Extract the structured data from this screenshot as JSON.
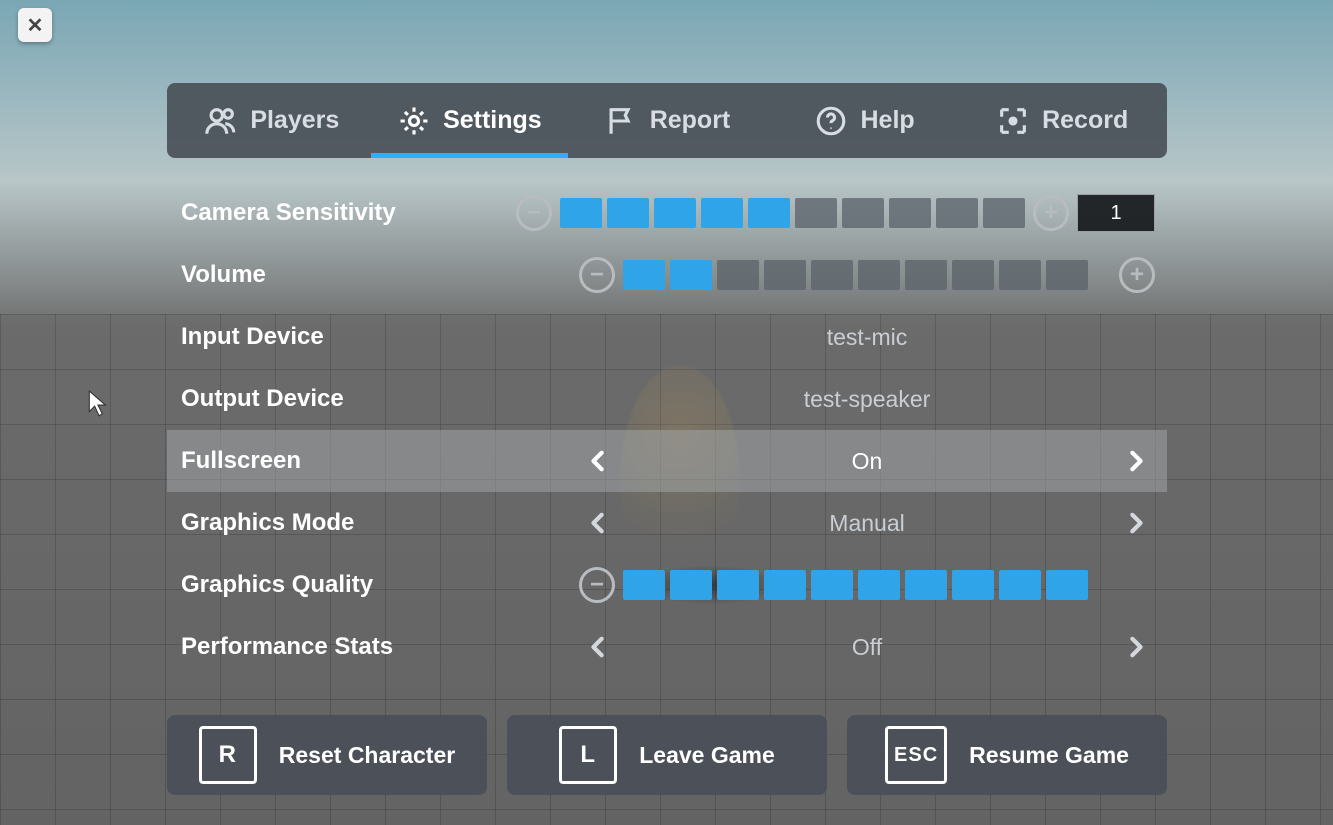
{
  "close_label": "✕",
  "tabs": {
    "players": "Players",
    "settings": "Settings",
    "report": "Report",
    "help": "Help",
    "record": "Record"
  },
  "settings": {
    "camera_sensitivity": {
      "label": "Camera Sensitivity",
      "filled": 5,
      "total": 10,
      "value": "1"
    },
    "volume": {
      "label": "Volume",
      "filled": 2,
      "total": 10
    },
    "input_device": {
      "label": "Input Device",
      "value": "test-mic"
    },
    "output_device": {
      "label": "Output Device",
      "value": "test-speaker"
    },
    "fullscreen": {
      "label": "Fullscreen",
      "value": "On"
    },
    "graphics_mode": {
      "label": "Graphics Mode",
      "value": "Manual"
    },
    "graphics_quality": {
      "label": "Graphics Quality",
      "filled": 10,
      "total": 10
    },
    "performance_stats": {
      "label": "Performance Stats",
      "value": "Off"
    }
  },
  "footer": {
    "reset": {
      "key": "R",
      "label": "Reset Character"
    },
    "leave": {
      "key": "L",
      "label": "Leave Game"
    },
    "resume": {
      "key": "ESC",
      "label": "Resume Game"
    }
  },
  "colors": {
    "accent": "#2fa4e8"
  }
}
